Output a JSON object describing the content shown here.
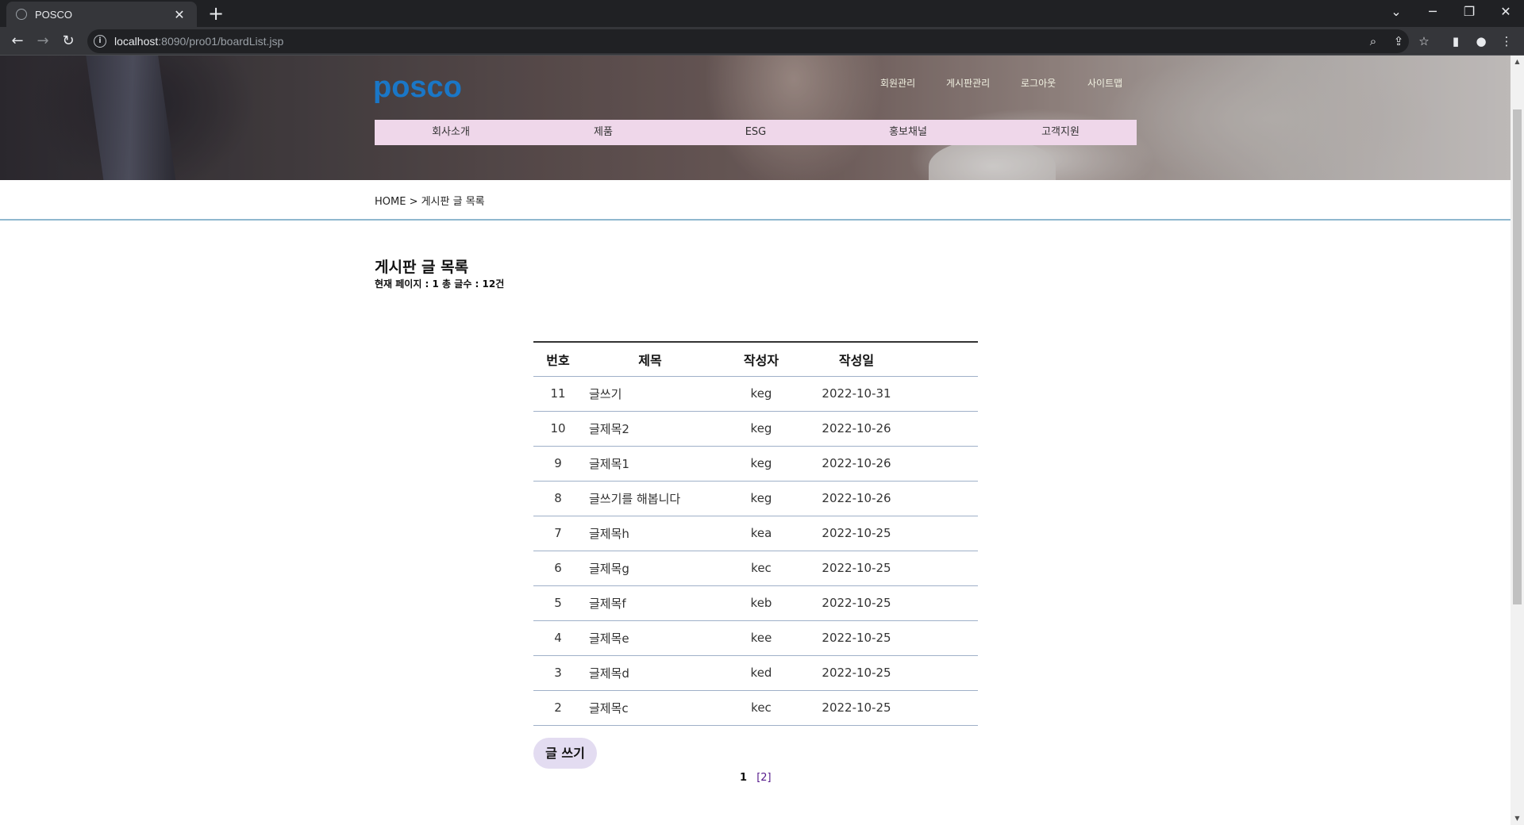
{
  "browser": {
    "tab_title": "POSCO",
    "url_host": "localhost",
    "url_rest": ":8090/pro01/boardList.jsp"
  },
  "header": {
    "logo": "posco",
    "top_menu": [
      "회원관리",
      "게시판관리",
      "로그아웃",
      "사이트맵"
    ],
    "gnb": [
      "회사소개",
      "제품",
      "ESG",
      "홍보채널",
      "고객지원"
    ]
  },
  "breadcrumb": "HOME > 게시판 글 목록",
  "board": {
    "title": "게시판 글 목록",
    "info": "현재 페이지 : 1 총 글수 : 12건",
    "columns": [
      "번호",
      "제목",
      "작성자",
      "작성일"
    ],
    "rows": [
      {
        "no": "11",
        "title": "글쓰기",
        "author": "keg",
        "date": "2022-10-31"
      },
      {
        "no": "10",
        "title": "글제목2",
        "author": "keg",
        "date": "2022-10-26"
      },
      {
        "no": "9",
        "title": "글제목1",
        "author": "keg",
        "date": "2022-10-26"
      },
      {
        "no": "8",
        "title": "글쓰기를 해봅니다",
        "author": "keg",
        "date": "2022-10-26"
      },
      {
        "no": "7",
        "title": "글제목h",
        "author": "kea",
        "date": "2022-10-25"
      },
      {
        "no": "6",
        "title": "글제목g",
        "author": "kec",
        "date": "2022-10-25"
      },
      {
        "no": "5",
        "title": "글제목f",
        "author": "keb",
        "date": "2022-10-25"
      },
      {
        "no": "4",
        "title": "글제목e",
        "author": "kee",
        "date": "2022-10-25"
      },
      {
        "no": "3",
        "title": "글제목d",
        "author": "ked",
        "date": "2022-10-25"
      },
      {
        "no": "2",
        "title": "글제목c",
        "author": "kec",
        "date": "2022-10-25"
      }
    ],
    "write_label": "글 쓰기",
    "pager": {
      "current": "1",
      "next": "[2]"
    }
  }
}
